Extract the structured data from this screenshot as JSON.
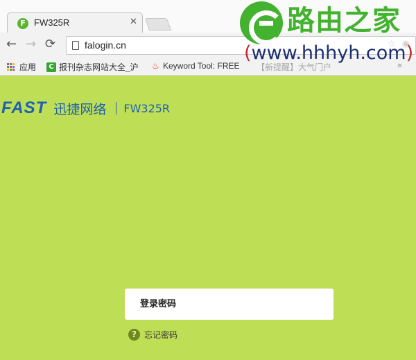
{
  "browser": {
    "tab": {
      "favicon_letter": "F",
      "title": "FW325R",
      "close": "✕"
    },
    "nav": {
      "back": "←",
      "forward": "→",
      "reload": "⟳"
    },
    "address": "falogin.cn",
    "bookmarks": [
      {
        "label": "应用"
      },
      {
        "icon_letter": "C",
        "label": "报刊杂志网站大全_沪"
      },
      {
        "icon_glyph": "♨",
        "label": "Keyword Tool: FREE"
      },
      {
        "label": "【新提醒】大气门户"
      }
    ],
    "more": "»"
  },
  "watermark": {
    "title": "路由之家",
    "url_open": "(",
    "url": "www.hhhyh.com",
    "url_close": ")"
  },
  "brand": {
    "logo": "FAST",
    "name": "迅捷网络",
    "model": "FW325R",
    "color": "#1e5fb4"
  },
  "login": {
    "password_placeholder": "登录密码",
    "help_glyph": "?",
    "forgot_label": "忘记密码"
  },
  "colors": {
    "page_background": "#bedf55",
    "watermark_green": "#43b22f",
    "watermark_blue": "#1b2e73",
    "watermark_red": "#c1272d"
  }
}
